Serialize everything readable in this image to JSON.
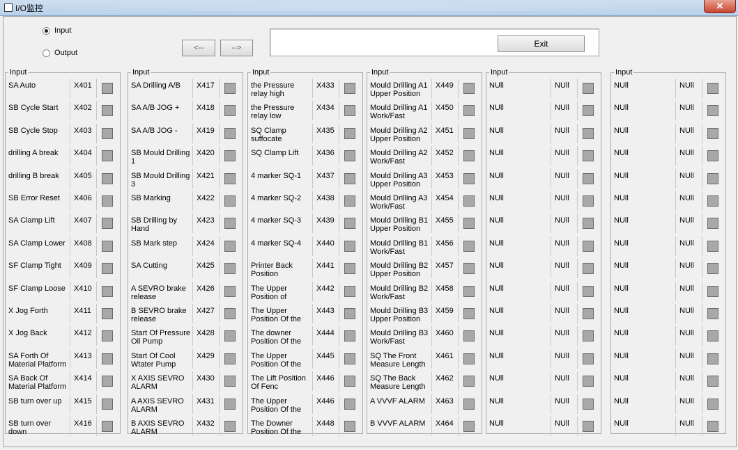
{
  "window": {
    "title": "I/O监控",
    "close_label": "✕"
  },
  "mode": {
    "options": [
      "Input",
      "Output"
    ],
    "selected": "Input"
  },
  "nav": {
    "prev_label": "<--",
    "next_label": "-->"
  },
  "exit_label": "Exit",
  "message": "",
  "colors": {
    "indicator_off": "#a8a8a8",
    "title_bar": "#b9d1ea",
    "close_button": "#c84530"
  },
  "groups": [
    {
      "label": "Input",
      "rows": [
        {
          "name": "SA Auto",
          "addr": "X401"
        },
        {
          "name": "SB Cycle Start",
          "addr": "X402"
        },
        {
          "name": "SB Cycle Stop",
          "addr": "X403"
        },
        {
          "name": "drilling A break",
          "addr": "X404"
        },
        {
          "name": "drilling B break",
          "addr": "X405"
        },
        {
          "name": "SB Error Reset",
          "addr": "X406"
        },
        {
          "name": "SA Clamp Lift",
          "addr": "X407"
        },
        {
          "name": "SA Clamp Lower",
          "addr": "X408"
        },
        {
          "name": "SF Clamp Tight",
          "addr": "X409"
        },
        {
          "name": "SF Clamp Loose",
          "addr": "X410"
        },
        {
          "name": "X Jog Forth",
          "addr": "X411"
        },
        {
          "name": "X Jog Back",
          "addr": "X412"
        },
        {
          "name": "SA Forth Of Material Platform",
          "addr": "X413"
        },
        {
          "name": "SA Back Of Material Platform",
          "addr": "X414"
        },
        {
          "name": "SB  turn over up",
          "addr": "X415"
        },
        {
          "name": "SB  turn over down",
          "addr": "X416"
        }
      ]
    },
    {
      "label": "Input",
      "rows": [
        {
          "name": "SA Drilling A/B",
          "addr": "X417"
        },
        {
          "name": "SA A/B JOG +",
          "addr": "X418"
        },
        {
          "name": "SA A/B JOG -",
          "addr": "X419"
        },
        {
          "name": "SB Mould Drilling 1",
          "addr": "X420"
        },
        {
          "name": "SB Mould Drilling 3",
          "addr": "X421"
        },
        {
          "name": "SB Marking",
          "addr": "X422"
        },
        {
          "name": "SB Drilling by Hand",
          "addr": "X423"
        },
        {
          "name": "SB Mark step",
          "addr": "X424"
        },
        {
          "name": "SA Cutting",
          "addr": "X425"
        },
        {
          "name": "A SEVRO brake release",
          "addr": "X426"
        },
        {
          "name": "B SEVRO brake release",
          "addr": "X427"
        },
        {
          "name": "Start Of Pressure Oil Pump",
          "addr": "X428"
        },
        {
          "name": "Start Of Cool Wtater Pump",
          "addr": "X429"
        },
        {
          "name": "X AXIS SEVRO ALARM",
          "addr": "X430"
        },
        {
          "name": "A AXIS SEVRO ALARM",
          "addr": "X431"
        },
        {
          "name": "B AXIS SEVRO ALARM",
          "addr": "X432"
        }
      ]
    },
    {
      "label": "Input",
      "rows": [
        {
          "name": "the Pressure relay high",
          "addr": "X433"
        },
        {
          "name": "the Pressure relay low",
          "addr": "X434"
        },
        {
          "name": "SQ Clamp suffocate",
          "addr": "X435"
        },
        {
          "name": "SQ Clamp Lift",
          "addr": "X436"
        },
        {
          "name": "4 marker SQ-1",
          "addr": "X437"
        },
        {
          "name": "4 marker SQ-2",
          "addr": "X438"
        },
        {
          "name": "4 marker SQ-3",
          "addr": "X439"
        },
        {
          "name": "4 marker SQ-4",
          "addr": "X440"
        },
        {
          "name": "Printer Back Position",
          "addr": "X441"
        },
        {
          "name": "The Upper Position of",
          "addr": "X442"
        },
        {
          "name": "The Upper Position Of the",
          "addr": "X443"
        },
        {
          "name": "The downer Position Of the",
          "addr": "X444"
        },
        {
          "name": "The Upper Position Of the",
          "addr": "X445"
        },
        {
          "name": "The  Lift Position Of Fenc",
          "addr": "X446"
        },
        {
          "name": "The Upper Position Of the",
          "addr": "X446"
        },
        {
          "name": "The Downer Position Of the",
          "addr": "X448"
        }
      ]
    },
    {
      "label": "Input",
      "rows": [
        {
          "name": "Mould Drilling A1 Upper Position",
          "addr": "X449"
        },
        {
          "name": "Mould Drilling A1 Work/Fast",
          "addr": "X450"
        },
        {
          "name": "Mould Drilling A2 Upper Position",
          "addr": "X451"
        },
        {
          "name": "Mould Drilling A2 Work/Fast",
          "addr": "X452"
        },
        {
          "name": "Mould Drilling A3 Upper Position",
          "addr": "X453"
        },
        {
          "name": "Mould Drilling A3 Work/Fast",
          "addr": "X454"
        },
        {
          "name": "Mould Drilling B1 Upper Position",
          "addr": "X455"
        },
        {
          "name": "Mould Drilling B1 Work/Fast",
          "addr": "X456"
        },
        {
          "name": "Mould Drilling B2 Upper Position",
          "addr": "X457"
        },
        {
          "name": "Mould Drilling B2 Work/Fast",
          "addr": "X458"
        },
        {
          "name": "Mould Drilling B3 Upper Position",
          "addr": "X459"
        },
        {
          "name": "Mould Drilling B3 Work/Fast",
          "addr": "X460"
        },
        {
          "name": "SQ The Front Measure Length",
          "addr": "X461"
        },
        {
          "name": "SQ The Back Measure Length",
          "addr": "X462"
        },
        {
          "name": "A VVVF ALARM",
          "addr": "X463"
        },
        {
          "name": "B VVVF ALARM",
          "addr": "X464"
        }
      ]
    },
    {
      "label": "Input",
      "rows": [
        {
          "name": "NUll",
          "addr": "NUll"
        },
        {
          "name": "NUll",
          "addr": "NUll"
        },
        {
          "name": "NUll",
          "addr": "NUll"
        },
        {
          "name": "NUll",
          "addr": "NUll"
        },
        {
          "name": "NUll",
          "addr": "NUll"
        },
        {
          "name": "NUll",
          "addr": "NUll"
        },
        {
          "name": "NUll",
          "addr": "NUll"
        },
        {
          "name": "NUll",
          "addr": "NUll"
        },
        {
          "name": "NUll",
          "addr": "NUll"
        },
        {
          "name": "NUll",
          "addr": "NUll"
        },
        {
          "name": "NUll",
          "addr": "NUll"
        },
        {
          "name": "NUll",
          "addr": "NUll"
        },
        {
          "name": "NUll",
          "addr": "NUll"
        },
        {
          "name": "NUll",
          "addr": "NUll"
        },
        {
          "name": "NUll",
          "addr": "NUll"
        },
        {
          "name": "NUll",
          "addr": "NUll"
        }
      ]
    },
    {
      "label": "Input",
      "rows": [
        {
          "name": "NUll",
          "addr": "NUll"
        },
        {
          "name": "NUll",
          "addr": "NUll"
        },
        {
          "name": "NUll",
          "addr": "NUll"
        },
        {
          "name": "NUll",
          "addr": "NUll"
        },
        {
          "name": "NUll",
          "addr": "NUll"
        },
        {
          "name": "NUll",
          "addr": "NUll"
        },
        {
          "name": "NUll",
          "addr": "NUll"
        },
        {
          "name": "NUll",
          "addr": "NUll"
        },
        {
          "name": "NUll",
          "addr": "NUll"
        },
        {
          "name": "NUll",
          "addr": "NUll"
        },
        {
          "name": "NUll",
          "addr": "NUll"
        },
        {
          "name": "NUll",
          "addr": "NUll"
        },
        {
          "name": "NUll",
          "addr": "NUll"
        },
        {
          "name": "NUll",
          "addr": "NUll"
        },
        {
          "name": "NUll",
          "addr": "NUll"
        },
        {
          "name": "NUll",
          "addr": "NUll"
        }
      ]
    }
  ]
}
